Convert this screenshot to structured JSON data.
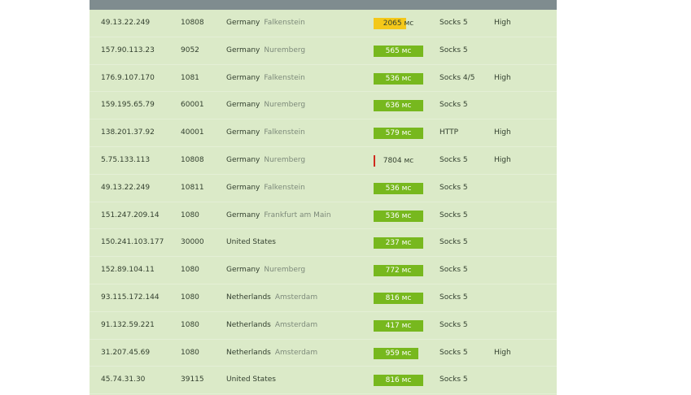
{
  "rows": [
    {
      "ip": "49.13.22.249",
      "port": "10808",
      "country": "Germany",
      "city": "Falkenstein",
      "speed_label": "2065 мс",
      "speed_fill": 0.65,
      "speed_status": "slow",
      "type": "Socks 5",
      "anonymity": "High"
    },
    {
      "ip": "157.90.113.23",
      "port": "9052",
      "country": "Germany",
      "city": "Nuremberg",
      "speed_label": "565 мс",
      "speed_fill": 1.0,
      "speed_status": "fast",
      "type": "Socks 5",
      "anonymity": ""
    },
    {
      "ip": "176.9.107.170",
      "port": "1081",
      "country": "Germany",
      "city": "Falkenstein",
      "speed_label": "536 мс",
      "speed_fill": 1.0,
      "speed_status": "fast",
      "type": "Socks 4/5",
      "anonymity": "High"
    },
    {
      "ip": "159.195.65.79",
      "port": "60001",
      "country": "Germany",
      "city": "Nuremberg",
      "speed_label": "636 мс",
      "speed_fill": 1.0,
      "speed_status": "fast",
      "type": "Socks 5",
      "anonymity": ""
    },
    {
      "ip": "138.201.37.92",
      "port": "40001",
      "country": "Germany",
      "city": "Falkenstein",
      "speed_label": "579 мс",
      "speed_fill": 1.0,
      "speed_status": "fast",
      "type": "HTTP",
      "anonymity": "High"
    },
    {
      "ip": "5.75.133.113",
      "port": "10808",
      "country": "Germany",
      "city": "Nuremberg",
      "speed_label": "7804 мс",
      "speed_fill": 0.03,
      "speed_status": "bad",
      "type": "Socks 5",
      "anonymity": "High"
    },
    {
      "ip": "49.13.22.249",
      "port": "10811",
      "country": "Germany",
      "city": "Falkenstein",
      "speed_label": "536 мс",
      "speed_fill": 1.0,
      "speed_status": "fast",
      "type": "Socks 5",
      "anonymity": ""
    },
    {
      "ip": "151.247.209.14",
      "port": "1080",
      "country": "Germany",
      "city": "Frankfurt am Main",
      "speed_label": "536 мс",
      "speed_fill": 1.0,
      "speed_status": "fast",
      "type": "Socks 5",
      "anonymity": ""
    },
    {
      "ip": "150.241.103.177",
      "port": "30000",
      "country": "United States",
      "city": "",
      "speed_label": "237 мс",
      "speed_fill": 1.0,
      "speed_status": "fast",
      "type": "Socks 5",
      "anonymity": ""
    },
    {
      "ip": "152.89.104.11",
      "port": "1080",
      "country": "Germany",
      "city": "Nuremberg",
      "speed_label": "772 мс",
      "speed_fill": 1.0,
      "speed_status": "fast",
      "type": "Socks 5",
      "anonymity": ""
    },
    {
      "ip": "93.115.172.144",
      "port": "1080",
      "country": "Netherlands",
      "city": "Amsterdam",
      "speed_label": "816 мс",
      "speed_fill": 1.0,
      "speed_status": "fast",
      "type": "Socks 5",
      "anonymity": ""
    },
    {
      "ip": "91.132.59.221",
      "port": "1080",
      "country": "Netherlands",
      "city": "Amsterdam",
      "speed_label": "417 мс",
      "speed_fill": 1.0,
      "speed_status": "fast",
      "type": "Socks 5",
      "anonymity": ""
    },
    {
      "ip": "31.207.45.69",
      "port": "1080",
      "country": "Netherlands",
      "city": "Amsterdam",
      "speed_label": "959 мс",
      "speed_fill": 0.9,
      "speed_status": "fast",
      "type": "Socks 5",
      "anonymity": "High"
    },
    {
      "ip": "45.74.31.30",
      "port": "39115",
      "country": "United States",
      "city": "",
      "speed_label": "816 мс",
      "speed_fill": 1.0,
      "speed_status": "fast",
      "type": "Socks 5",
      "anonymity": ""
    }
  ],
  "colors": {
    "fast": "#77b81e",
    "slow": "#f4c81a",
    "bad": "#cf2a1e",
    "table_bg": "#dbeac8",
    "header_bar": "#7f8c8f"
  }
}
